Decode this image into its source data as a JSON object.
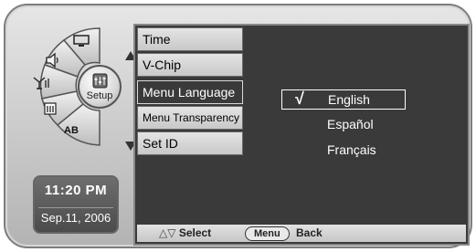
{
  "dial": {
    "center_label": "Setup",
    "segment_ab_label": "AB",
    "segment_icons": [
      "monitor-icon",
      "speaker-icon",
      "antenna-icon",
      "channel-list-icon",
      "ab-language-icon"
    ],
    "up_arrow": "up-arrow",
    "down_arrow": "down-arrow"
  },
  "clock": {
    "time": "11:20 PM",
    "date": "Sep.11, 2006"
  },
  "menu": {
    "items": [
      {
        "label": "Time"
      },
      {
        "label": "V-Chip"
      },
      {
        "label": "Menu Language"
      },
      {
        "label": "Menu Transparency"
      },
      {
        "label": "Set ID"
      }
    ],
    "active": "Menu Language"
  },
  "language_options": {
    "options": [
      {
        "label": "English",
        "selected": true,
        "check": "√"
      },
      {
        "label": "Español",
        "selected": false
      },
      {
        "label": "Français",
        "selected": false
      }
    ]
  },
  "footer": {
    "nav_arrows": "△▽",
    "select_label": "Select",
    "menu_button": "Menu",
    "back_label": "Back"
  }
}
